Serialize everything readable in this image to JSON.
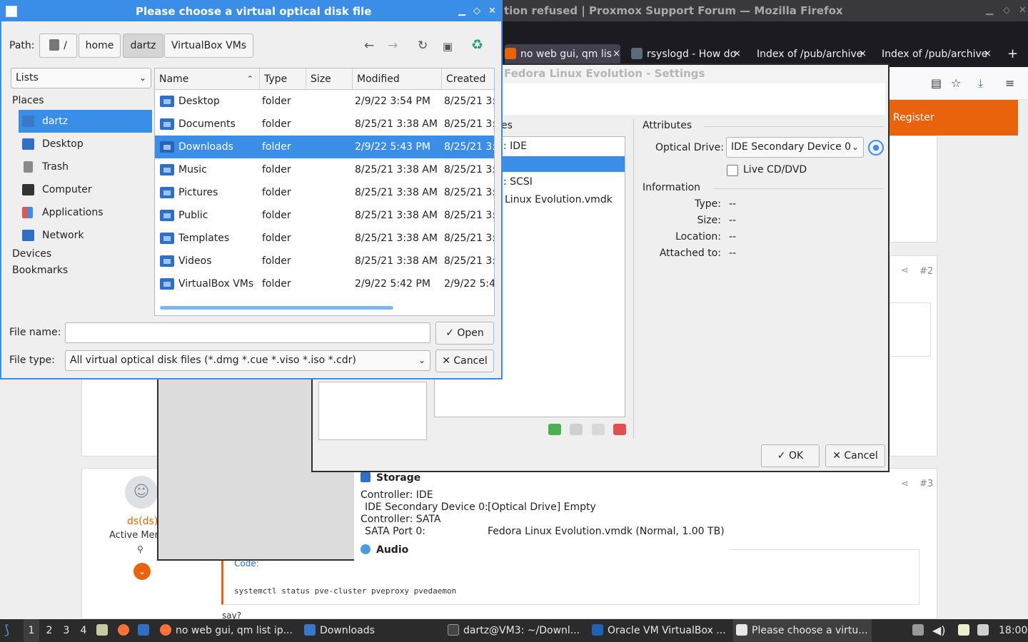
{
  "firefox": {
    "window_title": "tion refused | Proxmox Support Forum — Mozilla Firefox",
    "tabs": [
      {
        "label": "no web gui, qm lis"
      },
      {
        "label": "rsyslogd - How do"
      },
      {
        "label": "Index of /pub/archive"
      },
      {
        "label": "Index of /pub/archive"
      }
    ],
    "new_tab": "+",
    "close_glyph": "×",
    "register_label": "Register",
    "posts": [
      {
        "number": "#2"
      },
      {
        "number": "#3"
      }
    ],
    "user": {
      "name": "ds(ds)",
      "rank": "Active Mem"
    },
    "code_label": "Code:",
    "code_text": "systemctl status pve-cluster pveproxy pvedaemon",
    "reply_text": "say?"
  },
  "vbox_settings": {
    "title": "Fedora Linux Evolution - Settings",
    "tree_fragment_header": "es",
    "tree_items": [
      {
        "label": ": IDE"
      },
      {
        "label": ""
      },
      {
        "label": ": SCSI"
      },
      {
        "label": "Linux Evolution.vmdk"
      }
    ],
    "attributes_heading": "Attributes",
    "optical_drive_label": "Optical Drive:",
    "optical_drive_value": "IDE Secondary Device 0",
    "live_cd_label": "Live CD/DVD",
    "information_heading": "Information",
    "info": [
      {
        "key": "Type:",
        "value": "--"
      },
      {
        "key": "Size:",
        "value": "--"
      },
      {
        "key": "Location:",
        "value": "--"
      },
      {
        "key": "Attached to:",
        "value": "--"
      }
    ],
    "ok_label": "OK",
    "cancel_label": "Cancel"
  },
  "vm_details": {
    "storage_heading": "Storage",
    "rows": [
      {
        "key": "Controller: IDE",
        "value": ""
      },
      {
        "key": "IDE Secondary Device 0:",
        "value": "[Optical Drive] Empty"
      },
      {
        "key": "Controller: SATA",
        "value": ""
      },
      {
        "key": "SATA Port 0:",
        "value": "Fedora Linux Evolution.vmdk (Normal, 1.00 TB)"
      }
    ],
    "audio_heading": "Audio"
  },
  "file_chooser": {
    "title": "Please choose a virtual optical disk file",
    "path_label": "Path:",
    "breadcrumbs": [
      {
        "label": "/"
      },
      {
        "label": "home"
      },
      {
        "label": "dartz"
      },
      {
        "label": "VirtualBox VMs"
      }
    ],
    "view_mode": "Lists",
    "places_heading": "Places",
    "places": [
      {
        "label": "dartz",
        "color": "#3a78c9"
      },
      {
        "label": "Desktop",
        "color": "#2f6fc6"
      },
      {
        "label": "Trash",
        "color": "#8a8a8a"
      },
      {
        "label": "Computer",
        "color": "#333333"
      },
      {
        "label": "Applications",
        "color": "#e0574f"
      },
      {
        "label": "Network",
        "color": "#2f6fc6"
      }
    ],
    "devices_heading": "Devices",
    "bookmarks_heading": "Bookmarks",
    "columns": [
      "Name",
      "Type",
      "Size",
      "Modified",
      "Created"
    ],
    "files": [
      {
        "name": "Desktop",
        "type": "folder",
        "size": "",
        "modified": "2/9/22 3:54 PM",
        "created": "8/25/21 3:"
      },
      {
        "name": "Documents",
        "type": "folder",
        "size": "",
        "modified": "8/25/21 3:38 AM",
        "created": "8/25/21 3:"
      },
      {
        "name": "Downloads",
        "type": "folder",
        "size": "",
        "modified": "2/9/22 5:43 PM",
        "created": "8/25/21 3:"
      },
      {
        "name": "Music",
        "type": "folder",
        "size": "",
        "modified": "8/25/21 3:38 AM",
        "created": "8/25/21 3:"
      },
      {
        "name": "Pictures",
        "type": "folder",
        "size": "",
        "modified": "8/25/21 3:38 AM",
        "created": "8/25/21 3:"
      },
      {
        "name": "Public",
        "type": "folder",
        "size": "",
        "modified": "8/25/21 3:38 AM",
        "created": "8/25/21 3:"
      },
      {
        "name": "Templates",
        "type": "folder",
        "size": "",
        "modified": "8/25/21 3:38 AM",
        "created": "8/25/21 3:"
      },
      {
        "name": "Videos",
        "type": "folder",
        "size": "",
        "modified": "8/25/21 3:38 AM",
        "created": "8/25/21 3:"
      },
      {
        "name": "VirtualBox VMs",
        "type": "folder",
        "size": "",
        "modified": "2/9/22 5:42 PM",
        "created": "2/9/22 5:4"
      }
    ],
    "file_name_label": "File name:",
    "file_name_value": "",
    "file_type_label": "File type:",
    "file_type_value": "All virtual optical disk files (*.dmg *.cue *.viso *.iso *.cdr)",
    "open_label": "Open",
    "cancel_label": "Cancel"
  },
  "taskbar": {
    "workspaces": [
      "1",
      "2",
      "3",
      "4"
    ],
    "tasks": [
      {
        "label": "no web gui, qm list ip..."
      },
      {
        "label": "Downloads"
      },
      {
        "label": "dartz@VM3: ~/Downl..."
      },
      {
        "label": "Oracle VM VirtualBox ..."
      },
      {
        "label": "Please choose a virtu..."
      }
    ],
    "clock": "18:00"
  },
  "colors": {
    "selection": "#3a8ee6",
    "forum_accent": "#e9630c",
    "taskbar": "#2b2b2b"
  }
}
